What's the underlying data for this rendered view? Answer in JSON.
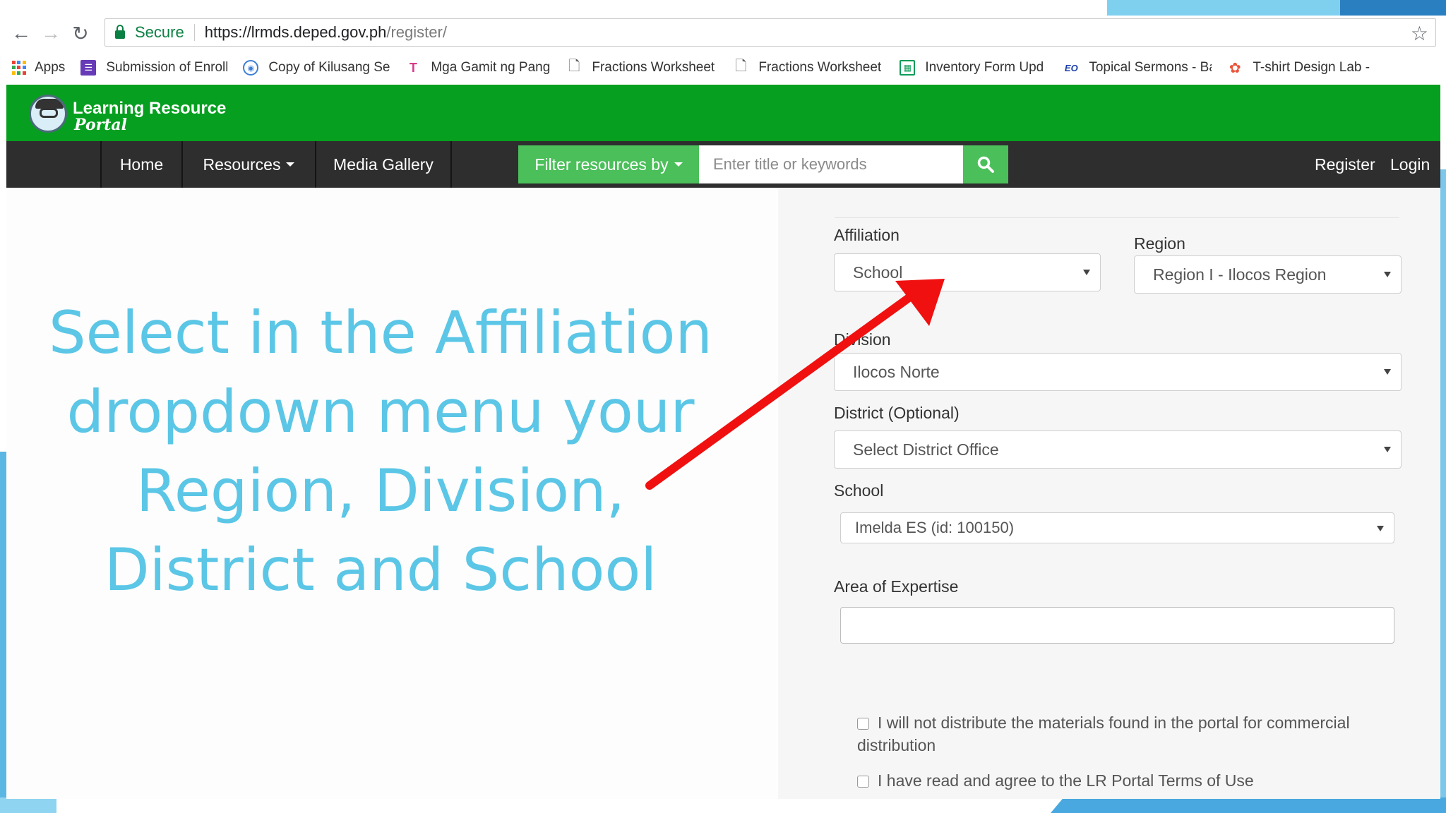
{
  "browser": {
    "secure_label": "Secure",
    "url_host": "https://lrmds.deped.gov.ph",
    "url_path": "/register/",
    "bookmarks": [
      {
        "label": "Apps",
        "icon": "apps-grid-icon"
      },
      {
        "label": "Submission of Enroll",
        "icon": "forms-icon"
      },
      {
        "label": "Copy of Kilusang Sel",
        "icon": "seal-icon"
      },
      {
        "label": "Mga Gamit ng Pang",
        "icon": "tl-icon"
      },
      {
        "label": "Fractions Worksheet",
        "icon": "page-icon"
      },
      {
        "label": "Fractions Worksheet",
        "icon": "page-icon"
      },
      {
        "label": "Inventory Form Upd",
        "icon": "sheets-icon"
      },
      {
        "label": "Topical Sermons - Ba",
        "icon": "eo-icon"
      },
      {
        "label": "T-shirt Design Lab -",
        "icon": "design-lab-icon"
      }
    ]
  },
  "site": {
    "logo_line1": "Learning Resource",
    "logo_line2": "Portal",
    "nav": {
      "home": "Home",
      "resources": "Resources",
      "media_gallery": "Media Gallery",
      "filter": "Filter resources by",
      "search_placeholder": "Enter title or keywords",
      "register": "Register",
      "login": "Login"
    }
  },
  "slide": {
    "instruction": "Select in the Affiliation dropdown menu your Region, Division, District and School",
    "colors": {
      "instruction": "#5bc6e6",
      "arrow": "#f01010",
      "header_green": "#069f1f",
      "nav_dark": "#2e2e2e",
      "button_green": "#4bbf5a"
    }
  },
  "form": {
    "affiliation": {
      "label": "Affiliation",
      "value": "School"
    },
    "region": {
      "label": "Region",
      "value": "Region I - Ilocos Region"
    },
    "division": {
      "label": "Division",
      "value": "Ilocos Norte"
    },
    "district": {
      "label": "District (Optional)",
      "value": "Select District Office"
    },
    "school": {
      "label": "School",
      "value": "Imelda ES (id: 100150)"
    },
    "expertise": {
      "label": "Area of Expertise",
      "value": ""
    },
    "checkbox1": "I will not distribute the materials found in the portal for commercial distribution",
    "checkbox2": "I have read and agree to the LR Portal Terms of Use"
  }
}
